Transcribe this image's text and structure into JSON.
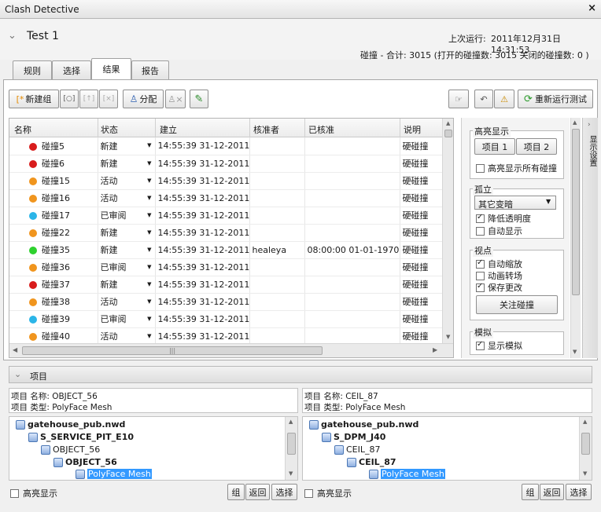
{
  "window": {
    "title": "Clash Detective",
    "close": "×"
  },
  "test": {
    "name": "Test 1",
    "last_run_label": "上次运行:",
    "last_run": "2011年12月31日 14:31:53",
    "summary": "碰撞 -  合计:  3015  (打开的碰撞数:  3015  关闭的碰撞数:  0 )"
  },
  "tabs": [
    "规则",
    "选择",
    "结果",
    "报告"
  ],
  "toolbar": {
    "new_group": "新建组",
    "assign": "分配",
    "rerun": "重新运行测试"
  },
  "columns": [
    "名称",
    "状态",
    "建立",
    "核准者",
    "已核准",
    "说明"
  ],
  "rows": [
    {
      "name": "碰撞5",
      "color": "#d81c1c",
      "status": "新建",
      "created": "14:55:39 31-12-2011",
      "approver": "",
      "approved": "",
      "desc": "硬碰撞"
    },
    {
      "name": "碰撞6",
      "color": "#d81c1c",
      "status": "新建",
      "created": "14:55:39 31-12-2011",
      "approver": "",
      "approved": "",
      "desc": "硬碰撞"
    },
    {
      "name": "碰撞15",
      "color": "#f0951e",
      "status": "活动",
      "created": "14:55:39 31-12-2011",
      "approver": "",
      "approved": "",
      "desc": "硬碰撞"
    },
    {
      "name": "碰撞16",
      "color": "#f0951e",
      "status": "活动",
      "created": "14:55:39 31-12-2011",
      "approver": "",
      "approved": "",
      "desc": "硬碰撞"
    },
    {
      "name": "碰撞17",
      "color": "#2bb5e8",
      "status": "已审阅",
      "created": "14:55:39 31-12-2011",
      "approver": "",
      "approved": "",
      "desc": "硬碰撞"
    },
    {
      "name": "碰撞22",
      "color": "#f0951e",
      "status": "新建",
      "created": "14:55:39 31-12-2011",
      "approver": "",
      "approved": "",
      "desc": "硬碰撞"
    },
    {
      "name": "碰撞35",
      "color": "#2ed12e",
      "status": "新建",
      "created": "14:55:39 31-12-2011",
      "approver": "healeya",
      "approved": "08:00:00 01-01-1970",
      "desc": "硬碰撞"
    },
    {
      "name": "碰撞36",
      "color": "#f0951e",
      "status": "已审阅",
      "created": "14:55:39 31-12-2011",
      "approver": "",
      "approved": "",
      "desc": "硬碰撞"
    },
    {
      "name": "碰撞37",
      "color": "#d81c1c",
      "status": "新建",
      "created": "14:55:39 31-12-2011",
      "approver": "",
      "approved": "",
      "desc": "硬碰撞"
    },
    {
      "name": "碰撞38",
      "color": "#f0951e",
      "status": "活动",
      "created": "14:55:39 31-12-2011",
      "approver": "",
      "approved": "",
      "desc": "硬碰撞"
    },
    {
      "name": "碰撞39",
      "color": "#2bb5e8",
      "status": "已审阅",
      "created": "14:55:39 31-12-2011",
      "approver": "",
      "approved": "",
      "desc": "硬碰撞"
    },
    {
      "name": "碰撞40",
      "color": "#f0951e",
      "status": "活动",
      "created": "14:55:39 31-12-2011",
      "approver": "",
      "approved": "",
      "desc": "硬碰撞"
    }
  ],
  "highlight": {
    "title": "高亮显示",
    "item1": "项目 1",
    "item2": "项目 2",
    "all": "高亮显示所有碰撞"
  },
  "isolate": {
    "title": "孤立",
    "select": "其它变暗",
    "dim": "降低透明度",
    "auto": "自动显示"
  },
  "viewpoint": {
    "title": "视点",
    "autozoom": "自动缩放",
    "anim": "动画转场",
    "save": "保存更改",
    "focus": "关注碰撞"
  },
  "sim": {
    "title": "模拟",
    "show": "显示模拟"
  },
  "side_tab": "显示设置",
  "items_title": "项目",
  "item1": {
    "name_line": "项目 名称:  OBJECT_56",
    "type_line": "项目 类型:  PolyFace Mesh",
    "tree": [
      "gatehouse_pub.nwd",
      "S_SERVICE_PIT_E10",
      "OBJECT_56",
      "OBJECT_56",
      "PolyFace Mesh"
    ]
  },
  "item2": {
    "name_line": "项目 名称:  CEIL_87",
    "type_line": "项目 类型:  PolyFace Mesh",
    "tree": [
      "gatehouse_pub.nwd",
      "S_DPM_J40",
      "CEIL_87",
      "CEIL_87",
      "PolyFace Mesh"
    ]
  },
  "bottom": {
    "highlight": "高亮显示",
    "group": "组",
    "back": "返回",
    "select": "选择"
  }
}
